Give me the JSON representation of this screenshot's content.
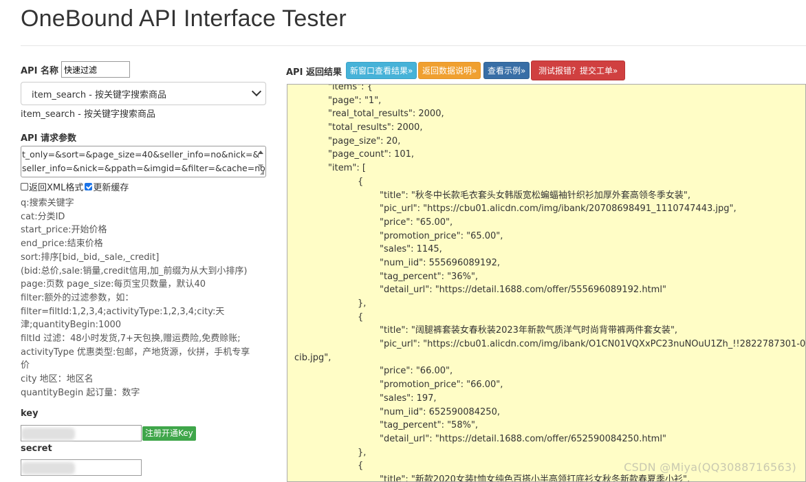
{
  "app": {
    "title": "OneBound API Interface Tester"
  },
  "left": {
    "api_name_label": "API 名称",
    "filter_value": "快速过滤",
    "selected_api": "item_search - 按关键字搜索商品",
    "selected_api_desc": "item_search - 按关键字搜索商品",
    "request_params_label": "API 请求参数",
    "params_lines": [
      "t_only=&sort=&page_size=40&seller_info=no&nick=&",
      "seller_info=&nick=&ppath=&imgid=&filter=&cache=no"
    ],
    "opt_xml_label": "返回XML格式",
    "opt_xml_checked": false,
    "opt_cache_label": "更新缓存",
    "opt_cache_checked": true,
    "help_lines": [
      "q:搜索关键字",
      "cat:分类ID",
      "start_price:开始价格",
      "end_price:结束价格",
      "sort:排序[bid,_bid,_sale,_credit]",
      "  (bid:总价,sale:销量,credit信用,加_前缀为从大到小排序)",
      "page:页数  page_size:每页宝贝数量，默认40",
      "filter:额外的过滤参数，如：",
      "filter=filtId:1,2,3,4;activityType:1,2,3,4;city:天",
      "津;quantityBegin:1000",
      "filtId 过滤：48小时发货,7+天包换,赠运费险,免费赊账;",
      "activityType 优惠类型:包邮，产地货源，伙拼，手机专享",
      "价",
      "city 地区：地区名",
      "quantityBegin 起订量：数字"
    ],
    "key_label": "key",
    "register_key_button": "注册开通Key",
    "secret_label": "secret"
  },
  "right": {
    "result_label": "API 返回结果",
    "btn_new_window": "新窗口查看结果»",
    "btn_data_desc": "返回数据说明»",
    "btn_example": "查看示例»",
    "btn_report": "测试报错？提交工单»",
    "json_lines": [
      {
        "indent": 1,
        "text": "\"items\": {"
      },
      {
        "indent": 1,
        "text": "\"page\": \"1\","
      },
      {
        "indent": 1,
        "text": "\"real_total_results\": 2000,"
      },
      {
        "indent": 1,
        "text": "\"total_results\": 2000,"
      },
      {
        "indent": 1,
        "text": "\"page_size\": 20,"
      },
      {
        "indent": 1,
        "text": "\"page_count\": 101,"
      },
      {
        "indent": 1,
        "text": "\"item\": ["
      },
      {
        "indent": 2,
        "text": "{"
      },
      {
        "indent": 3,
        "text": "\"title\": \"秋冬中长款毛衣套头女韩版宽松蝙蝠袖针织衫加厚外套高领冬季女装\","
      },
      {
        "indent": 3,
        "text": "\"pic_url\": \"https://cbu01.alicdn.com/img/ibank/20708698491_1110747443.jpg\","
      },
      {
        "indent": 3,
        "text": "\"price\": \"65.00\","
      },
      {
        "indent": 3,
        "text": "\"promotion_price\": \"65.00\","
      },
      {
        "indent": 3,
        "text": "\"sales\": 1145,"
      },
      {
        "indent": 3,
        "text": "\"num_iid\": 555696089192,"
      },
      {
        "indent": 3,
        "text": "\"tag_percent\": \"36%\","
      },
      {
        "indent": 3,
        "text": "\"detail_url\": \"https://detail.1688.com/offer/555696089192.html\""
      },
      {
        "indent": 2,
        "text": "},"
      },
      {
        "indent": 2,
        "text": "{"
      },
      {
        "indent": 3,
        "text": "\"title\": \"阔腿裤套装女春秋装2023年新款气质洋气时尚背带裤两件套女装\","
      },
      {
        "indent": 3,
        "text": "\"pic_url\": \"https://cbu01.alicdn.com/img/ibank/O1CN01VQXxPC23nuNOuU1Zh_!!2822787301-0-"
      },
      {
        "indent": 0,
        "text": "cib.jpg\","
      },
      {
        "indent": 3,
        "text": "\"price\": \"66.00\","
      },
      {
        "indent": 3,
        "text": "\"promotion_price\": \"66.00\","
      },
      {
        "indent": 3,
        "text": "\"sales\": 197,"
      },
      {
        "indent": 3,
        "text": "\"num_iid\": 652590084250,"
      },
      {
        "indent": 3,
        "text": "\"tag_percent\": \"58%\","
      },
      {
        "indent": 3,
        "text": "\"detail_url\": \"https://detail.1688.com/offer/652590084250.html\""
      },
      {
        "indent": 2,
        "text": "},"
      },
      {
        "indent": 2,
        "text": "{"
      },
      {
        "indent": 3,
        "text": "\"title\": \"新款2020女装t恤女纯色百搭小半高领打底衫女秋冬新款春夏季小衫\","
      }
    ]
  },
  "watermark": "CSDN @Miya(QQ3088716563)",
  "colors": {
    "result_bg": "#fffdc6",
    "btn_info": "#46b2d8",
    "btn_warning": "#f0a030",
    "btn_primary": "#386ea6",
    "btn_danger": "#d04040",
    "btn_success": "#3fa64a"
  }
}
